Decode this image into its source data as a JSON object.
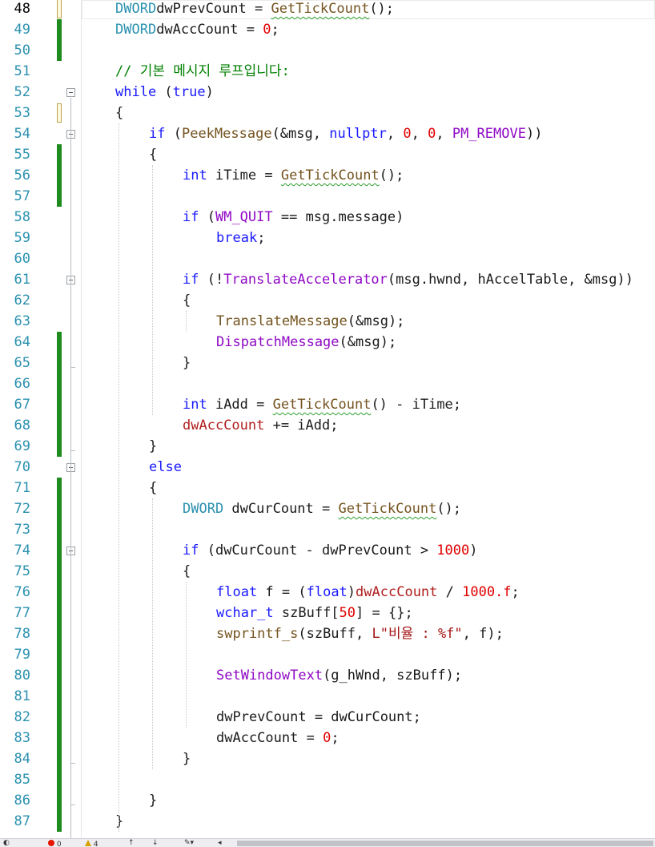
{
  "editor": {
    "first_line": 48,
    "current_line": 48,
    "lines": [
      {
        "n": "48",
        "indent": 1,
        "change": "unsaved",
        "tokens": [
          [
            "ty",
            "DWORD"
          ],
          [
            "",
            "dwPrevCount = "
          ],
          [
            "fnsq",
            "GetTickCount"
          ],
          [
            "",
            "();"
          ]
        ]
      },
      {
        "n": "49",
        "indent": 1,
        "change": "saved",
        "tokens": [
          [
            "ty",
            "DWORD"
          ],
          [
            "",
            "dwAccCount = "
          ],
          [
            "num",
            "0"
          ],
          [
            "",
            ";"
          ]
        ]
      },
      {
        "n": "50",
        "indent": 0,
        "change": "saved",
        "tokens": []
      },
      {
        "n": "51",
        "indent": 1,
        "change": "",
        "tokens": [
          [
            "cm",
            "// 기본 메시지 루프입니다:"
          ]
        ]
      },
      {
        "n": "52",
        "indent": 1,
        "change": "",
        "fold": "open",
        "tokens": [
          [
            "kw",
            "while"
          ],
          [
            "",
            " ("
          ],
          [
            "kw",
            "true"
          ],
          [
            "",
            ")"
          ]
        ]
      },
      {
        "n": "53",
        "indent": 1,
        "change": "unsaved",
        "tokens": [
          [
            "",
            "{"
          ]
        ]
      },
      {
        "n": "54",
        "indent": 2,
        "change": "",
        "fold": "open",
        "tokens": [
          [
            "kw",
            "if"
          ],
          [
            "",
            " ("
          ],
          [
            "fn",
            "PeekMessage"
          ],
          [
            "",
            "(&msg, "
          ],
          [
            "kw",
            "nullptr"
          ],
          [
            "",
            ", "
          ],
          [
            "num",
            "0"
          ],
          [
            "",
            ", "
          ],
          [
            "num",
            "0"
          ],
          [
            "",
            ", "
          ],
          [
            "mac",
            "PM_REMOVE"
          ],
          [
            "",
            "))"
          ]
        ]
      },
      {
        "n": "55",
        "indent": 2,
        "change": "saved",
        "tokens": [
          [
            "",
            "{"
          ]
        ]
      },
      {
        "n": "56",
        "indent": 3,
        "change": "saved",
        "tokens": [
          [
            "kw",
            "int"
          ],
          [
            "",
            " iTime = "
          ],
          [
            "fnsq",
            "GetTickCount"
          ],
          [
            "",
            "();"
          ]
        ]
      },
      {
        "n": "57",
        "indent": 0,
        "change": "saved",
        "tokens": []
      },
      {
        "n": "58",
        "indent": 3,
        "change": "",
        "tokens": [
          [
            "kw",
            "if"
          ],
          [
            "",
            " ("
          ],
          [
            "mac",
            "WM_QUIT"
          ],
          [
            "",
            " == msg.message)"
          ]
        ]
      },
      {
        "n": "59",
        "indent": 4,
        "change": "",
        "tokens": [
          [
            "kw",
            "break"
          ],
          [
            "",
            ";"
          ]
        ]
      },
      {
        "n": "60",
        "indent": 0,
        "change": "",
        "tokens": []
      },
      {
        "n": "61",
        "indent": 3,
        "change": "",
        "fold": "open",
        "tokens": [
          [
            "kw",
            "if"
          ],
          [
            "",
            " (!"
          ],
          [
            "mac",
            "TranslateAccelerator"
          ],
          [
            "",
            "(msg.hwnd, hAccelTable, &msg))"
          ]
        ]
      },
      {
        "n": "62",
        "indent": 3,
        "change": "",
        "tokens": [
          [
            "",
            "{"
          ]
        ]
      },
      {
        "n": "63",
        "indent": 4,
        "change": "",
        "tokens": [
          [
            "fn",
            "TranslateMessage"
          ],
          [
            "",
            "(&msg);"
          ]
        ]
      },
      {
        "n": "64",
        "indent": 4,
        "change": "saved",
        "tokens": [
          [
            "mac",
            "DispatchMessage"
          ],
          [
            "",
            "(&msg);"
          ]
        ]
      },
      {
        "n": "65",
        "indent": 3,
        "change": "saved",
        "foldend": true,
        "tokens": [
          [
            "",
            "}"
          ]
        ]
      },
      {
        "n": "66",
        "indent": 0,
        "change": "saved",
        "tokens": []
      },
      {
        "n": "67",
        "indent": 3,
        "change": "saved",
        "tokens": [
          [
            "kw",
            "int"
          ],
          [
            "",
            " iAdd = "
          ],
          [
            "fnsq",
            "GetTickCount"
          ],
          [
            "",
            "() - iTime;"
          ]
        ]
      },
      {
        "n": "68",
        "indent": 3,
        "change": "saved",
        "tokens": [
          [
            "gv",
            "dwAccCount"
          ],
          [
            "",
            " += iAdd;"
          ]
        ]
      },
      {
        "n": "69",
        "indent": 2,
        "change": "saved",
        "foldend": true,
        "tokens": [
          [
            "",
            "}"
          ]
        ]
      },
      {
        "n": "70",
        "indent": 2,
        "change": "",
        "fold": "open",
        "tokens": [
          [
            "kw",
            "else"
          ]
        ]
      },
      {
        "n": "71",
        "indent": 2,
        "change": "saved",
        "tokens": [
          [
            "",
            "{"
          ]
        ]
      },
      {
        "n": "72",
        "indent": 3,
        "change": "saved",
        "tokens": [
          [
            "ty",
            "DWORD"
          ],
          [
            "",
            " dwCurCount = "
          ],
          [
            "fnsq",
            "GetTickCount"
          ],
          [
            "",
            "();"
          ]
        ]
      },
      {
        "n": "73",
        "indent": 0,
        "change": "saved",
        "tokens": []
      },
      {
        "n": "74",
        "indent": 3,
        "change": "saved",
        "fold": "open",
        "tokens": [
          [
            "kw",
            "if"
          ],
          [
            "",
            " (dwCurCount - dwPrevCount > "
          ],
          [
            "num",
            "1000"
          ],
          [
            "",
            ")"
          ]
        ]
      },
      {
        "n": "75",
        "indent": 3,
        "change": "saved",
        "tokens": [
          [
            "",
            "{"
          ]
        ]
      },
      {
        "n": "76",
        "indent": 4,
        "change": "saved",
        "tokens": [
          [
            "kw",
            "float"
          ],
          [
            "",
            " f = ("
          ],
          [
            "kw",
            "float"
          ],
          [
            "",
            ")"
          ],
          [
            "gv",
            "dwAccCount"
          ],
          [
            "",
            " / "
          ],
          [
            "num",
            "1000.f"
          ],
          [
            "",
            ";"
          ]
        ]
      },
      {
        "n": "77",
        "indent": 4,
        "change": "saved",
        "tokens": [
          [
            "kw",
            "wchar_t"
          ],
          [
            "",
            " szBuff["
          ],
          [
            "num",
            "50"
          ],
          [
            "",
            "] = {};"
          ]
        ]
      },
      {
        "n": "78",
        "indent": 4,
        "change": "saved",
        "tokens": [
          [
            "fn",
            "swprintf_s"
          ],
          [
            "",
            "(szBuff, "
          ],
          [
            "str",
            "L\"비율 : %f\""
          ],
          [
            "",
            ", f);"
          ]
        ]
      },
      {
        "n": "79",
        "indent": 0,
        "change": "saved",
        "tokens": []
      },
      {
        "n": "80",
        "indent": 4,
        "change": "saved",
        "tokens": [
          [
            "mac",
            "SetWindowText"
          ],
          [
            "",
            "(g_hWnd, szBuff);"
          ]
        ]
      },
      {
        "n": "81",
        "indent": 0,
        "change": "saved",
        "tokens": []
      },
      {
        "n": "82",
        "indent": 4,
        "change": "saved",
        "tokens": [
          [
            "",
            "dwPrevCount = dwCurCount;"
          ]
        ]
      },
      {
        "n": "83",
        "indent": 4,
        "change": "saved",
        "tokens": [
          [
            "",
            "dwAccCount = "
          ],
          [
            "num",
            "0"
          ],
          [
            "",
            ";"
          ]
        ]
      },
      {
        "n": "84",
        "indent": 3,
        "change": "saved",
        "foldend": true,
        "tokens": [
          [
            "",
            "}"
          ]
        ]
      },
      {
        "n": "85",
        "indent": 0,
        "change": "saved",
        "tokens": []
      },
      {
        "n": "86",
        "indent": 2,
        "change": "saved",
        "foldend": true,
        "tokens": [
          [
            "",
            "}"
          ]
        ]
      },
      {
        "n": "87",
        "indent": 1,
        "change": "saved",
        "tokens": [
          [
            "",
            "}"
          ]
        ]
      }
    ]
  },
  "status": {
    "errors": "0",
    "warnings": "4"
  },
  "colors": {
    "keyword": "#1a1aff",
    "function": "#74531f",
    "macro": "#8f08c4",
    "type": "#2b91af",
    "number": "#e00000",
    "string": "#a31515",
    "comment": "#008000",
    "change_saved": "#1e8b1e"
  }
}
